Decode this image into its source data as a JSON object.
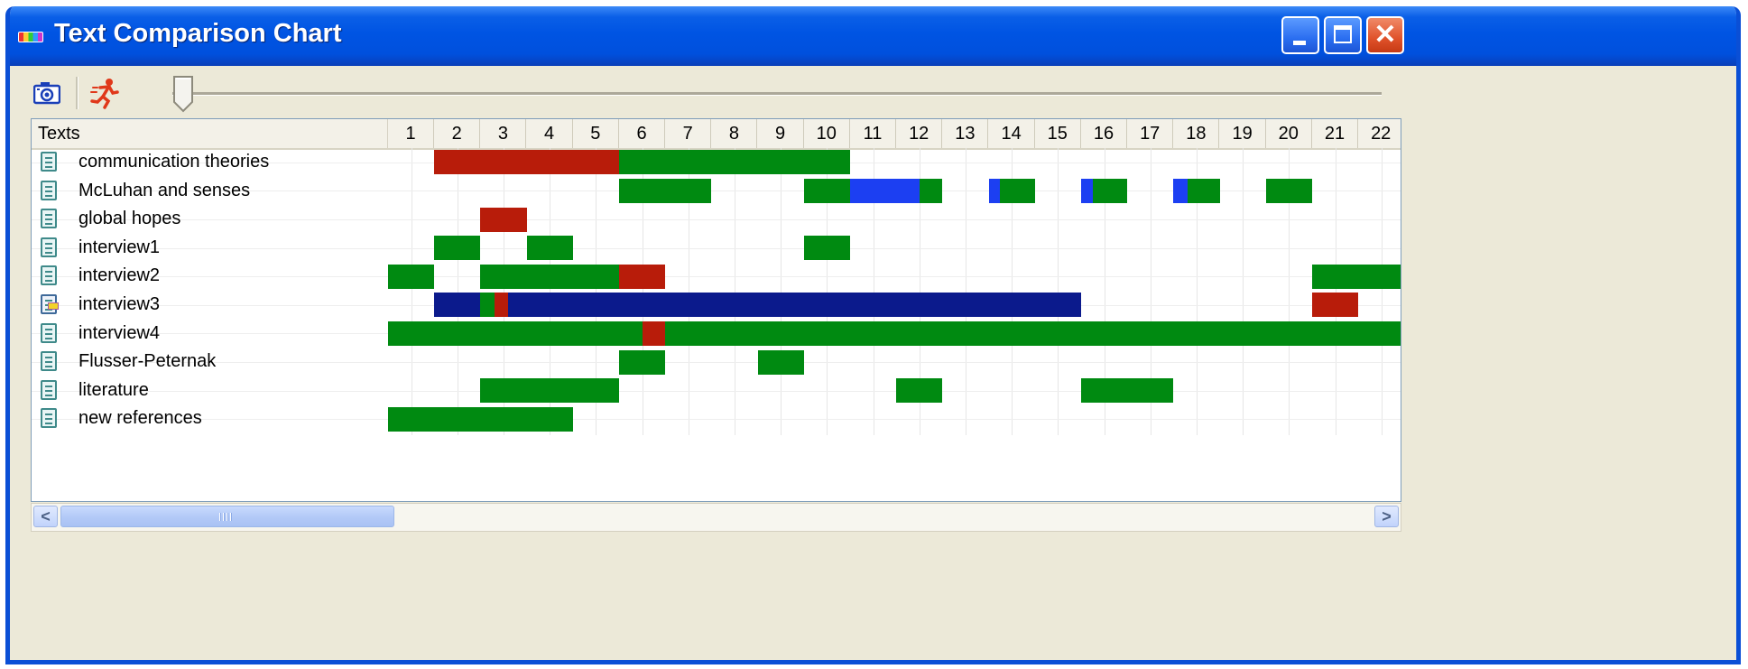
{
  "window": {
    "title": "Text Comparison Chart",
    "controls": {
      "minimize": "minimize",
      "maximize": "maximize",
      "close": "✕"
    }
  },
  "toolbar": {
    "camera_icon": "camera-icon",
    "run_icon": "running-man-icon",
    "slider_level": 0
  },
  "grid": {
    "header_label": "Texts",
    "columns": [
      "1",
      "2",
      "3",
      "4",
      "5",
      "6",
      "7",
      "8",
      "9",
      "10",
      "11",
      "12",
      "13",
      "14",
      "15",
      "16",
      "17",
      "18",
      "19",
      "20",
      "21",
      "22"
    ],
    "rows": [
      {
        "label": "communication theories",
        "icon": "document-icon",
        "segments": [
          {
            "start": 2,
            "end": 6,
            "color": "#b81c0a"
          },
          {
            "start": 6,
            "end": 11,
            "color": "#008a11"
          }
        ]
      },
      {
        "label": "McLuhan and senses",
        "icon": "document-icon",
        "segments": [
          {
            "start": 6,
            "end": 8,
            "color": "#008a11"
          },
          {
            "start": 10,
            "end": 11,
            "color": "#008a11"
          },
          {
            "start": 11,
            "end": 12.5,
            "color": "#1c3ff2"
          },
          {
            "start": 12.5,
            "end": 13,
            "color": "#008a11"
          },
          {
            "start": 14,
            "end": 14.25,
            "color": "#1c3ff2"
          },
          {
            "start": 14.25,
            "end": 15,
            "color": "#008a11"
          },
          {
            "start": 16,
            "end": 16.25,
            "color": "#1c3ff2"
          },
          {
            "start": 16.25,
            "end": 17,
            "color": "#008a11"
          },
          {
            "start": 18,
            "end": 18.3,
            "color": "#1c3ff2"
          },
          {
            "start": 18.3,
            "end": 19,
            "color": "#008a11"
          },
          {
            "start": 20,
            "end": 21,
            "color": "#008a11"
          }
        ]
      },
      {
        "label": "global hopes",
        "icon": "document-icon",
        "segments": [
          {
            "start": 3,
            "end": 4,
            "color": "#b81c0a"
          }
        ]
      },
      {
        "label": "interview1",
        "icon": "document-icon",
        "segments": [
          {
            "start": 2,
            "end": 3,
            "color": "#008a11"
          },
          {
            "start": 4,
            "end": 5,
            "color": "#008a11"
          },
          {
            "start": 10,
            "end": 11,
            "color": "#008a11"
          }
        ]
      },
      {
        "label": "interview2",
        "icon": "document-icon",
        "segments": [
          {
            "start": 1,
            "end": 2,
            "color": "#008a11"
          },
          {
            "start": 3,
            "end": 6,
            "color": "#008a11"
          },
          {
            "start": 6,
            "end": 7,
            "color": "#b81c0a"
          },
          {
            "start": 21,
            "end": 23,
            "color": "#008a11"
          }
        ]
      },
      {
        "label": "interview3",
        "icon": "document-marked-icon",
        "segments": [
          {
            "start": 2,
            "end": 3,
            "color": "#0b1a8c"
          },
          {
            "start": 3,
            "end": 3.3,
            "color": "#008a11"
          },
          {
            "start": 3.3,
            "end": 3.6,
            "color": "#b81c0a"
          },
          {
            "start": 3.6,
            "end": 16,
            "color": "#0b1a8c"
          },
          {
            "start": 21,
            "end": 22,
            "color": "#b81c0a"
          }
        ]
      },
      {
        "label": "interview4",
        "icon": "document-icon",
        "segments": [
          {
            "start": 1,
            "end": 6.5,
            "color": "#008a11"
          },
          {
            "start": 6.5,
            "end": 7,
            "color": "#b81c0a"
          },
          {
            "start": 7,
            "end": 23,
            "color": "#008a11"
          }
        ]
      },
      {
        "label": "Flusser-Peternak",
        "icon": "document-icon",
        "segments": [
          {
            "start": 6,
            "end": 7,
            "color": "#008a11"
          },
          {
            "start": 9,
            "end": 10,
            "color": "#008a11"
          }
        ]
      },
      {
        "label": "literature",
        "icon": "document-icon",
        "segments": [
          {
            "start": 3,
            "end": 6,
            "color": "#008a11"
          },
          {
            "start": 12,
            "end": 13,
            "color": "#008a11"
          },
          {
            "start": 16,
            "end": 18,
            "color": "#008a11"
          }
        ]
      },
      {
        "label": "new references",
        "icon": "document-icon",
        "segments": [
          {
            "start": 1,
            "end": 5,
            "color": "#008a11"
          }
        ]
      }
    ]
  },
  "scrollbar": {
    "left_arrow": "<",
    "right_arrow": ">",
    "position": 0
  },
  "colors": {
    "title_bar": "#0054e3",
    "match_green": "#008a11",
    "match_red": "#b81c0a",
    "match_blue": "#1c3ff2",
    "match_navy": "#0b1a8c"
  }
}
